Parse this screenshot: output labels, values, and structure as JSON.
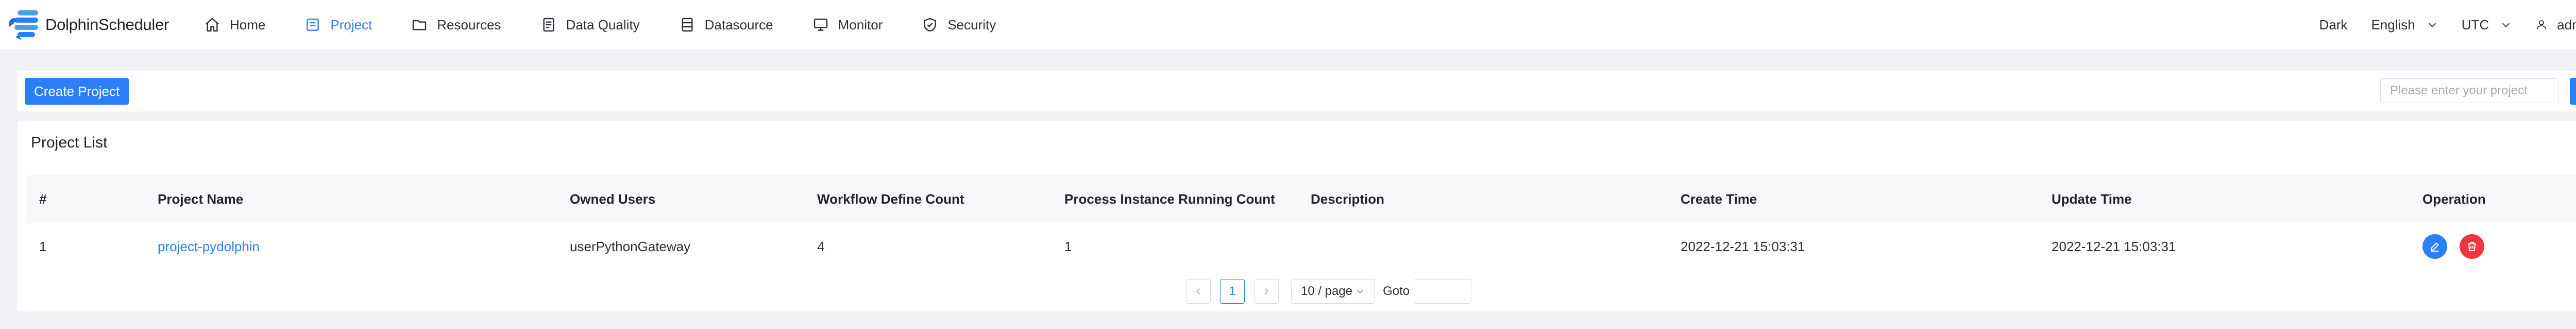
{
  "app": {
    "name": "DolphinScheduler"
  },
  "nav": {
    "items": [
      {
        "label": "Home",
        "icon": "home-icon",
        "active": false
      },
      {
        "label": "Project",
        "icon": "project-icon",
        "active": true
      },
      {
        "label": "Resources",
        "icon": "folder-icon",
        "active": false
      },
      {
        "label": "Data Quality",
        "icon": "data-quality-icon",
        "active": false
      },
      {
        "label": "Datasource",
        "icon": "database-icon",
        "active": false
      },
      {
        "label": "Monitor",
        "icon": "monitor-icon",
        "active": false
      },
      {
        "label": "Security",
        "icon": "shield-icon",
        "active": false
      }
    ]
  },
  "header_right": {
    "theme": "Dark",
    "language": "English",
    "timezone": "UTC",
    "user": "admin"
  },
  "toolbar": {
    "create_label": "Create Project",
    "search_placeholder": "Please enter your project",
    "search_value": ""
  },
  "project_list": {
    "title": "Project List",
    "columns": [
      "#",
      "Project Name",
      "Owned Users",
      "Workflow Define Count",
      "Process Instance Running Count",
      "Description",
      "Create Time",
      "Update Time",
      "Operation"
    ],
    "rows": [
      {
        "index": "1",
        "name": "project-pydolphin",
        "owned_users": "userPythonGateway",
        "workflow_define_count": "4",
        "process_instance_running_count": "1",
        "description": "",
        "create_time": "2022-12-21 15:03:31",
        "update_time": "2022-12-21 15:03:31"
      }
    ]
  },
  "pagination": {
    "current_page": "1",
    "page_size": "10 / page",
    "goto_label": "Goto",
    "goto_value": ""
  },
  "colors": {
    "accent": "#2d7ff9",
    "danger": "#f5333f",
    "page_bg": "#f1f2f5"
  }
}
